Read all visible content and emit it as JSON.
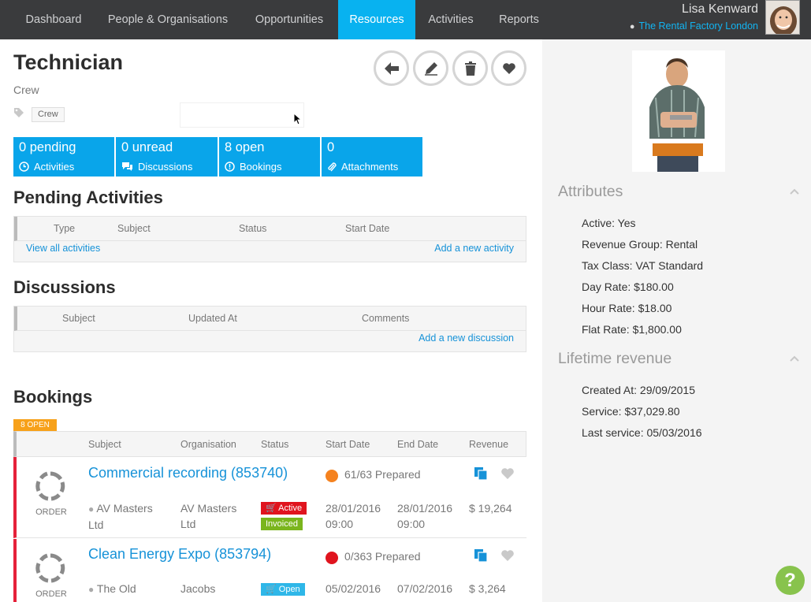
{
  "nav": {
    "items": [
      "Dashboard",
      "People & Organisations",
      "Opportunities",
      "Resources",
      "Activities",
      "Reports"
    ],
    "active": "Resources",
    "user_name": "Lisa Kenward",
    "user_org": "The Rental Factory London"
  },
  "header": {
    "title": "Technician",
    "subtitle": "Crew",
    "tag": "Crew"
  },
  "counters": [
    {
      "num": "0 pending",
      "label": "Activities",
      "icon": "clock-icon"
    },
    {
      "num": "0 unread",
      "label": "Discussions",
      "icon": "chat-icon"
    },
    {
      "num": "8 open",
      "label": "Bookings",
      "icon": "alert-circle-icon"
    },
    {
      "num": "0",
      "label": "Attachments",
      "icon": "paperclip-icon"
    }
  ],
  "pending": {
    "title": "Pending Activities",
    "columns": [
      "Type",
      "Subject",
      "Status",
      "Start Date"
    ],
    "view_all": "View all activities",
    "add_new": "Add a new activity"
  },
  "discussions": {
    "title": "Discussions",
    "columns": [
      "Subject",
      "Updated At",
      "Comments"
    ],
    "add_new": "Add a new discussion"
  },
  "bookings": {
    "title": "Bookings",
    "badge": "8 OPEN",
    "columns": [
      "Subject",
      "Organisation",
      "Status",
      "Start Date",
      "End Date",
      "Revenue"
    ],
    "rows": [
      {
        "type": "ORDER",
        "subject": "Commercial recording (853740)",
        "prepared": "61/63 Prepared",
        "dot_color": "#f5821f",
        "venue_1": "AV Masters",
        "venue_2": "Ltd",
        "org_1": "AV Masters",
        "org_2": "Ltd",
        "status_1": "Active",
        "status_2": "Invoiced",
        "start_1": "28/01/2016",
        "start_2": "09:00",
        "end_1": "28/01/2016",
        "end_2": "09:00",
        "revenue": "$ 19,264"
      },
      {
        "type": "ORDER",
        "subject": "Clean Energy Expo (853794)",
        "prepared": "0/363 Prepared",
        "dot_color": "#e0141e",
        "venue_1": "The Old",
        "venue_2": "",
        "org_1": "Jacobs",
        "org_2": "",
        "status_1": "Open",
        "status_2": "",
        "start_1": "05/02/2016",
        "start_2": "",
        "end_1": "07/02/2016",
        "end_2": "",
        "revenue": "$ 3,264"
      }
    ]
  },
  "attributes": {
    "title": "Attributes",
    "items": [
      "Active: Yes",
      "Revenue Group: Rental",
      "Tax Class: VAT Standard",
      "Day Rate: $180.00",
      "Hour Rate: $18.00",
      "Flat Rate: $1,800.00"
    ]
  },
  "lifetime": {
    "title": "Lifetime revenue",
    "items": [
      "Created At: 29/09/2015",
      "Service: $37,029.80",
      "Last service: 05/03/2016"
    ]
  },
  "help": "?",
  "colors": {
    "nav_bg": "#3a3b3d",
    "accent": "#08b2f0",
    "counter_bg": "#09a5ea",
    "booking_border": "#e5213a",
    "active_pill": "#e0141e",
    "invoiced_pill": "#7ab51d",
    "open_pill": "#2fb7e8",
    "badge": "#f7a11a"
  }
}
